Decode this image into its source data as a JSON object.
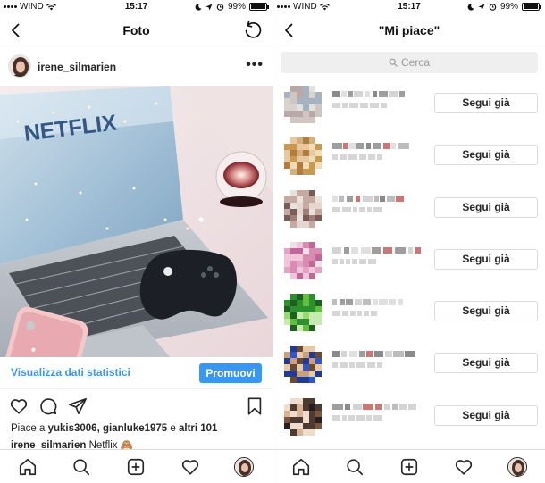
{
  "status_left": {
    "carrier": "WIND",
    "time": "15:17",
    "battery_text": "99%",
    "battery_level": 0.99
  },
  "status_right": {
    "carrier": "WIND",
    "time": "15:17",
    "battery_text": "99%",
    "battery_level": 0.99
  },
  "photo_screen": {
    "title": "Foto",
    "post": {
      "username": "irene_silmarien",
      "image_text": "NETFLIX",
      "stats_link": "Visualizza dati statistici",
      "promote_label": "Promuovi",
      "likes_prefix": "Piace a ",
      "liker_1": "yukis3006",
      "liker_sep": ", ",
      "liker_2": "gianluke1975",
      "likes_mid": " e ",
      "likes_others": "altri 101",
      "caption_user": "irene_silmarien",
      "caption_text": " Netflix 🙈"
    }
  },
  "likes_screen": {
    "title": "\"Mi piace\"",
    "search_placeholder": "Cerca",
    "follow_label": "Segui già",
    "follow_buttons": [
      "Segui già",
      "Segui già",
      "Segui già",
      "Segui già",
      "Segui già",
      "Segui già",
      "Segui già"
    ]
  },
  "icons": {
    "back": "chevron-left-icon",
    "refresh": "refresh-icon",
    "more": "more-options-icon",
    "like": "heart-icon",
    "comment": "comment-icon",
    "share": "send-icon",
    "save": "bookmark-icon",
    "tabs": [
      "home-icon",
      "search-icon",
      "add-post-icon",
      "activity-heart-icon",
      "profile-avatar-icon"
    ]
  },
  "colors": {
    "accent": "#3897f0",
    "text": "#262626",
    "divider": "#dbdbdb"
  }
}
